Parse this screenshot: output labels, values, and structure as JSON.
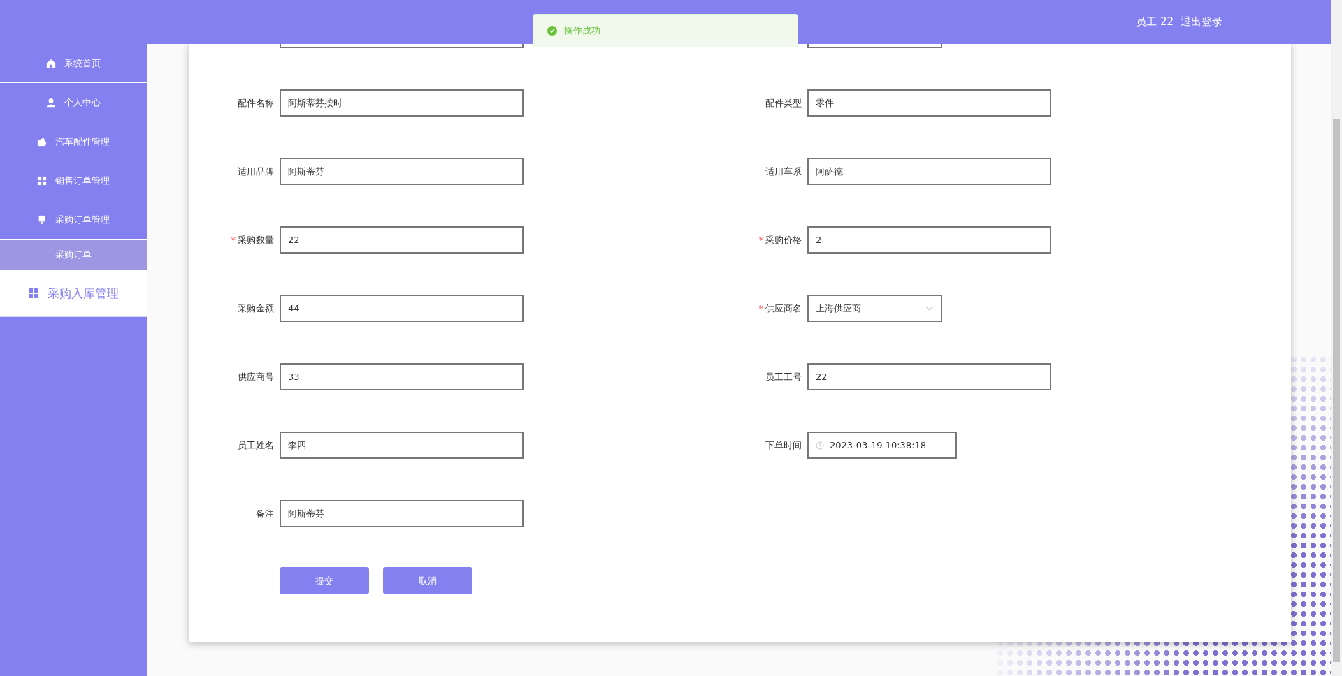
{
  "header": {
    "user": "员工 22",
    "logout": "退出登录"
  },
  "toast": {
    "message": "操作成功"
  },
  "sidebar": {
    "items": [
      {
        "label": "系统首页",
        "selected": false
      },
      {
        "label": "个人中心",
        "selected": false
      },
      {
        "label": "汽车配件管理",
        "selected": false
      },
      {
        "label": "销售订单管理",
        "selected": false
      },
      {
        "label": "采购订单管理",
        "selected": false,
        "children": [
          {
            "label": "采购订单",
            "selected": false
          }
        ]
      },
      {
        "label": "采购入库管理",
        "selected": true
      }
    ]
  },
  "form": {
    "scrolled_row": [
      {
        "kind": "text"
      },
      {
        "kind": "select"
      }
    ],
    "fields": [
      {
        "kind": "text",
        "label": "配件名称",
        "value": "阿斯蒂芬按时"
      },
      {
        "kind": "text",
        "label": "配件类型",
        "value": "零件"
      },
      {
        "kind": "text",
        "label": "适用品牌",
        "value": "阿斯蒂芬"
      },
      {
        "kind": "text",
        "label": "适用车系",
        "value": "阿萨德"
      },
      {
        "kind": "text",
        "label": "采购数量",
        "value": "22",
        "required_mark": "*"
      },
      {
        "kind": "text",
        "label": "采购价格",
        "value": "2",
        "required_mark": "*"
      },
      {
        "kind": "text",
        "label": "采购金额",
        "value": "44"
      },
      {
        "kind": "select",
        "label": "供应商名",
        "value": "上海供应商",
        "required_mark": "*"
      },
      {
        "kind": "text",
        "label": "供应商号",
        "value": "33"
      },
      {
        "kind": "text",
        "label": "员工工号",
        "value": "22"
      },
      {
        "kind": "text",
        "label": "员工姓名",
        "value": "李四"
      },
      {
        "kind": "date",
        "label": "下单时间",
        "value": "2023-03-19 10:38:18"
      },
      {
        "kind": "text",
        "label": "备注",
        "value": "阿斯蒂芬"
      }
    ],
    "buttons": [
      "提交",
      "取消"
    ]
  }
}
